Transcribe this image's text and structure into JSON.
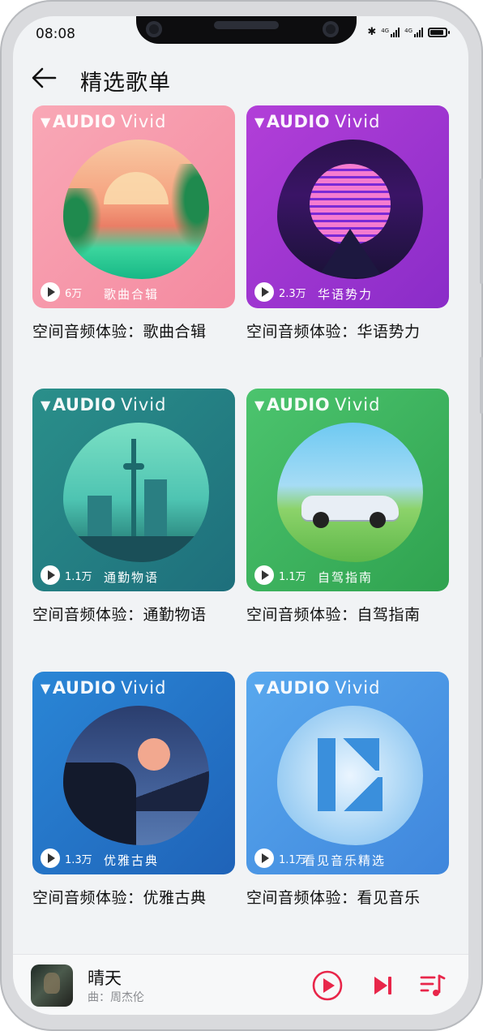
{
  "status": {
    "time": "08:08",
    "network1": "4G",
    "network2": "4G"
  },
  "header": {
    "title": "精选歌单"
  },
  "playlists": [
    {
      "cover_brand": "AUDIO",
      "cover_brand2": "Vivid",
      "plays": "6万",
      "cover_label": "歌曲合辑",
      "title": "空间音频体验：歌曲合辑"
    },
    {
      "cover_brand": "AUDIO",
      "cover_brand2": "Vivid",
      "plays": "2.3万",
      "cover_label": "华语势力",
      "title": "空间音频体验：华语势力"
    },
    {
      "cover_brand": "AUDIO",
      "cover_brand2": "Vivid",
      "plays": "1.1万",
      "cover_label": "通勤物语",
      "title": "空间音频体验：通勤物语"
    },
    {
      "cover_brand": "AUDIO",
      "cover_brand2": "Vivid",
      "plays": "1.1万",
      "cover_label": "自驾指南",
      "title": "空间音频体验：自驾指南"
    },
    {
      "cover_brand": "AUDIO",
      "cover_brand2": "Vivid",
      "plays": "1.3万",
      "cover_label": "优雅古典",
      "title": "空间音频体验：优雅古典"
    },
    {
      "cover_brand": "AUDIO",
      "cover_brand2": "Vivid",
      "plays": "1.1万",
      "cover_label": "看见音乐精选",
      "title": "空间音频体验：看见音乐"
    }
  ],
  "player": {
    "song": "晴天",
    "artist": "曲：周杰伦"
  },
  "colors": {
    "accent": "#e8264a",
    "background": "#f1f3f5"
  }
}
